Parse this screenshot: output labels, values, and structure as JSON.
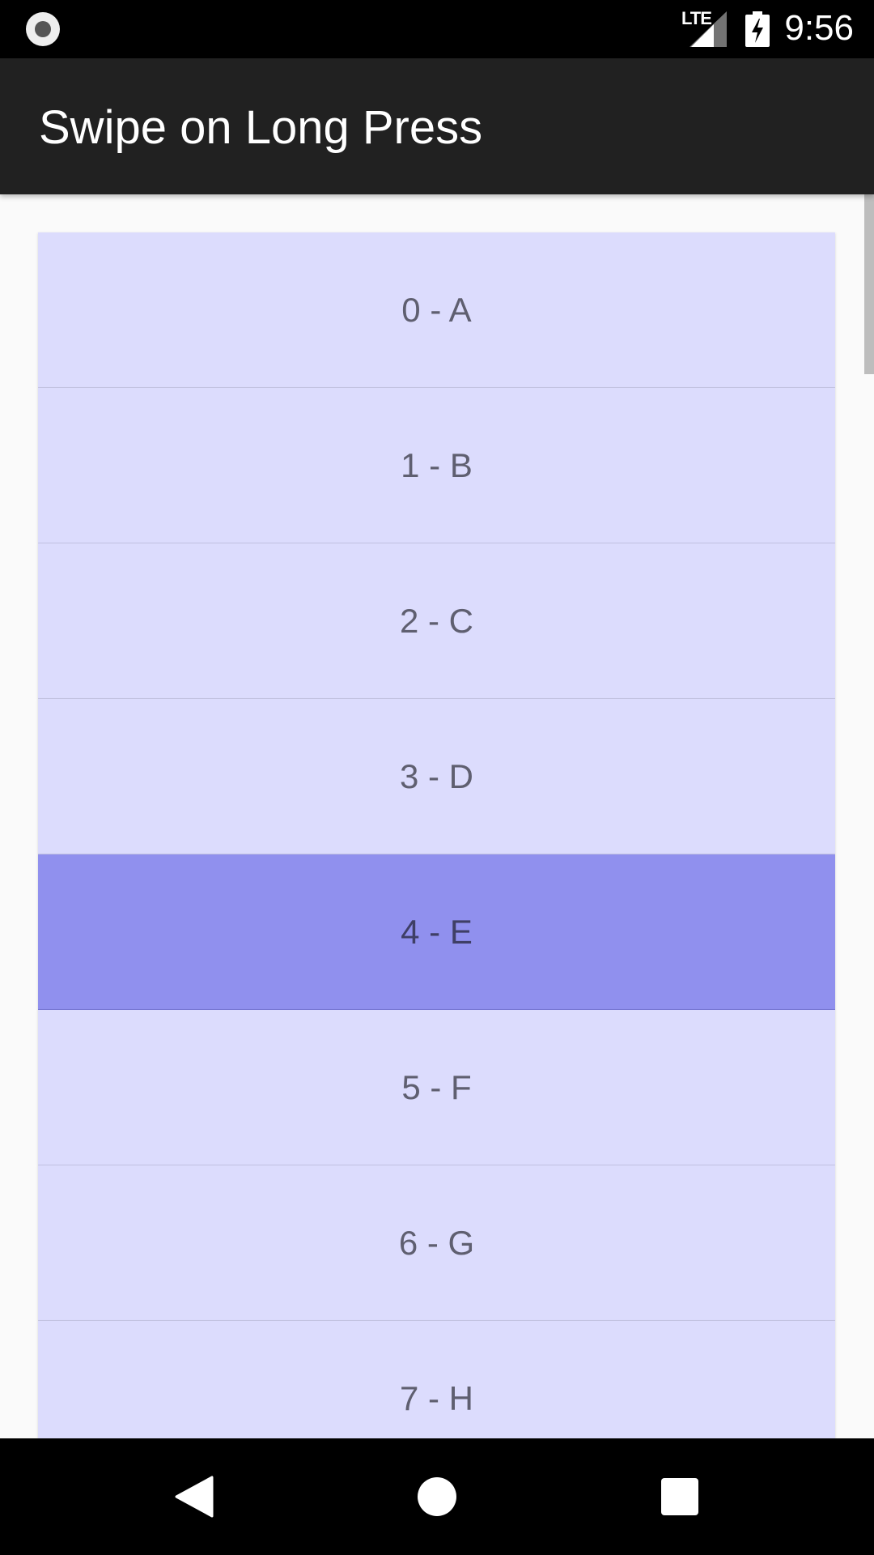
{
  "status_bar": {
    "network_label": "LTE",
    "time": "9:56",
    "icons": [
      "recording-dot-icon",
      "signal-icon",
      "battery-charging-icon"
    ]
  },
  "app_bar": {
    "title": "Swipe on Long Press"
  },
  "list": {
    "items": [
      {
        "label": "0 - A",
        "selected": false
      },
      {
        "label": "1 - B",
        "selected": false
      },
      {
        "label": "2 - C",
        "selected": false
      },
      {
        "label": "3 - D",
        "selected": false
      },
      {
        "label": "4 - E",
        "selected": true
      },
      {
        "label": "5 - F",
        "selected": false
      },
      {
        "label": "6 - G",
        "selected": false
      },
      {
        "label": "7 - H",
        "selected": false
      }
    ]
  },
  "colors": {
    "item_background": "#dcdcfd",
    "item_selected_background": "#9090ee",
    "app_bar_background": "#212121"
  },
  "nav_bar": {
    "icons": [
      "back-icon",
      "home-icon",
      "recents-icon"
    ]
  }
}
